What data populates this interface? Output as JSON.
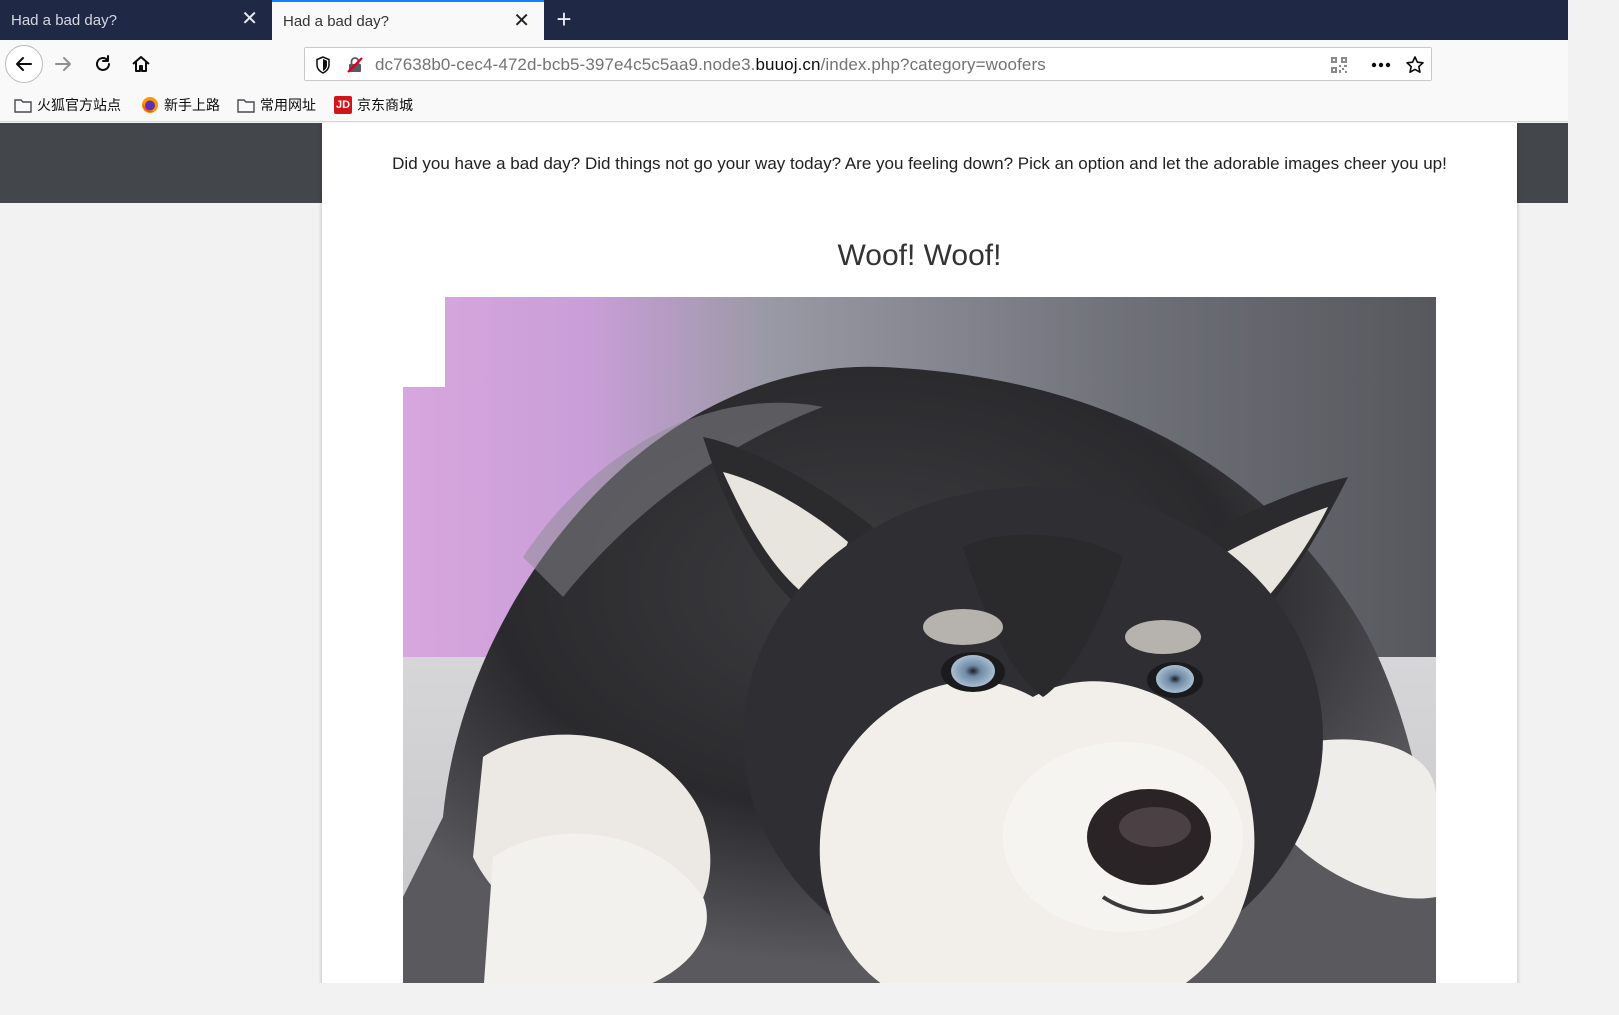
{
  "browser": {
    "tabs": [
      {
        "title": "Had a bad day?",
        "active": false
      },
      {
        "title": "Had a bad day?",
        "active": true
      }
    ],
    "new_tab_label": "+",
    "url": {
      "prefix": "dc7638b0-cec4-472d-bcb5-397e4c5c5aa9.node3.",
      "host": "buuoj.cn",
      "path": "/index.php?category=woofers"
    },
    "bookmarks": [
      {
        "label": "火狐官方站点",
        "icon": "folder-icon"
      },
      {
        "label": "新手上路",
        "icon": "firefox-icon"
      },
      {
        "label": "常用网址",
        "icon": "folder-icon"
      },
      {
        "label": "京东商城",
        "icon": "jd-icon",
        "icon_text": "JD"
      }
    ]
  },
  "page": {
    "intro": "Did you have a bad day? Did things not go your way today? Are you feeling down? Pick an option and let the adorable images cheer you up!",
    "heading": "Woof! Woof!",
    "image_subject": "husky-dog-photo"
  },
  "colors": {
    "tabstrip": "#1f2845",
    "active_tab_accent": "#0a84ff",
    "header_band": "#43464b",
    "page_bg": "#f2f2f2",
    "card_bg": "#ffffff"
  }
}
